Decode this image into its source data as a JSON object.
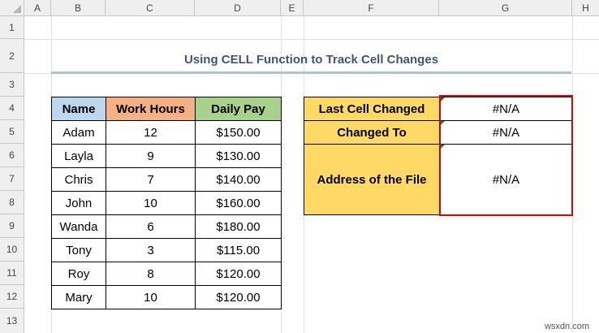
{
  "columns": [
    "A",
    "B",
    "C",
    "D",
    "E",
    "F",
    "G",
    "H"
  ],
  "rows": [
    "1",
    "2",
    "3",
    "4",
    "5",
    "6",
    "7",
    "8",
    "9",
    "10",
    "11",
    "12",
    "13"
  ],
  "title": "Using CELL Function to Track Cell Changes",
  "table": {
    "headers": [
      "Name",
      "Work Hours",
      "Daily Pay"
    ],
    "header_colors": [
      "#bdd7ee",
      "#f4b183",
      "#a9d18e"
    ],
    "rows": [
      [
        "Adam",
        "12",
        "$150.00"
      ],
      [
        "Layla",
        "9",
        "$130.00"
      ],
      [
        "Chris",
        "7",
        "$140.00"
      ],
      [
        "John",
        "10",
        "$160.00"
      ],
      [
        "Wanda",
        "6",
        "$180.00"
      ],
      [
        "Tony",
        "3",
        "$115.00"
      ],
      [
        "Roy",
        "8",
        "$120.00"
      ],
      [
        "Mary",
        "10",
        "$120.00"
      ]
    ]
  },
  "info": {
    "last_cell_label": "Last Cell Changed",
    "last_cell_value": "#N/A",
    "changed_to_label": "Changed To",
    "changed_to_value": "#N/A",
    "address_label": "Address of the File",
    "address_value": "#N/A"
  },
  "colors": {
    "label_fill": "#ffd966",
    "highlight_border": "#e00000",
    "title_color": "#44546a"
  },
  "watermark": "wsxdn.com"
}
